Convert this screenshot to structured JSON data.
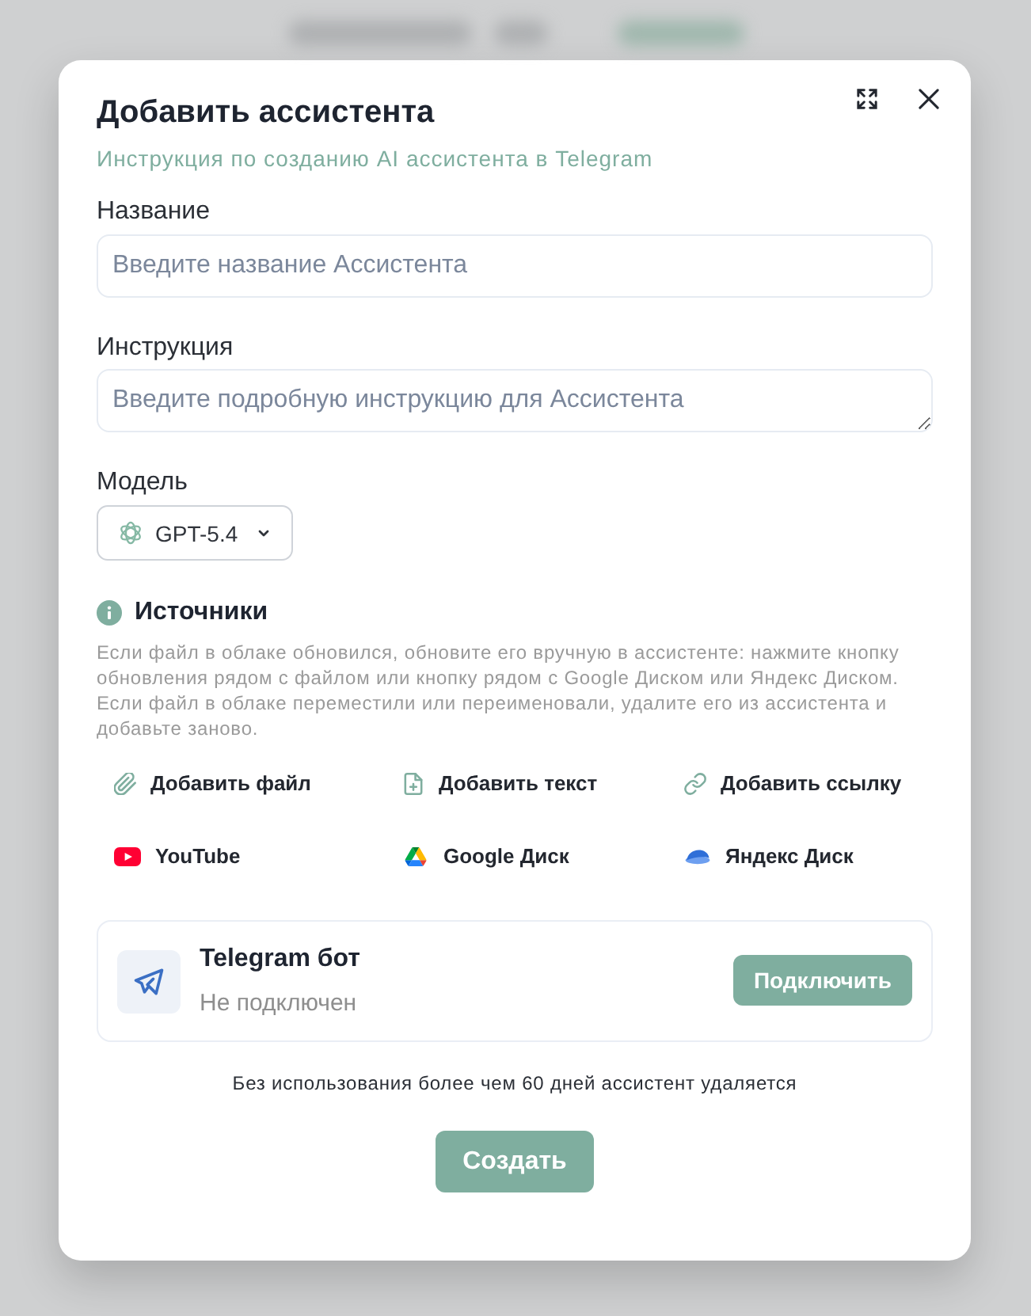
{
  "dialog": {
    "title": "Добавить ассистента",
    "guide_link": "Инструкция по созданию AI ассистента в Telegram",
    "fields": [
      {
        "kind": "input",
        "label": "Название",
        "placeholder": "Введите название Ассистента"
      },
      {
        "kind": "textarea",
        "label": "Инструкция",
        "placeholder": "Введите подробную инструкцию для Ассистента"
      }
    ],
    "model": {
      "label": "Модель",
      "value": "GPT-5.4"
    },
    "sources": {
      "title": "Источники",
      "description": "Если файл в облаке обновился, обновите его вручную в ассистенте: нажмите кнопку обновления рядом с файлом или кнопку рядом с Google Диском или Яндекс Диском. Если файл в облаке переместили или переименовали, удалите его из ассистента и добавьте заново.",
      "actions": [
        {
          "kind": "file",
          "label": "Добавить файл"
        },
        {
          "kind": "text",
          "label": "Добавить текст"
        },
        {
          "kind": "link",
          "label": "Добавить ссылку"
        },
        {
          "kind": "youtube",
          "label": "YouTube"
        },
        {
          "kind": "google_drive",
          "label": "Google Диск"
        },
        {
          "kind": "yandex_disk",
          "label": "Яндекс Диск"
        }
      ]
    },
    "telegram": {
      "title": "Telegram бот",
      "status": "Не подключен",
      "connect_button": "Подключить"
    },
    "notice": "Без использования более чем 60 дней ассистент удаляется",
    "submit_button": "Создать"
  }
}
